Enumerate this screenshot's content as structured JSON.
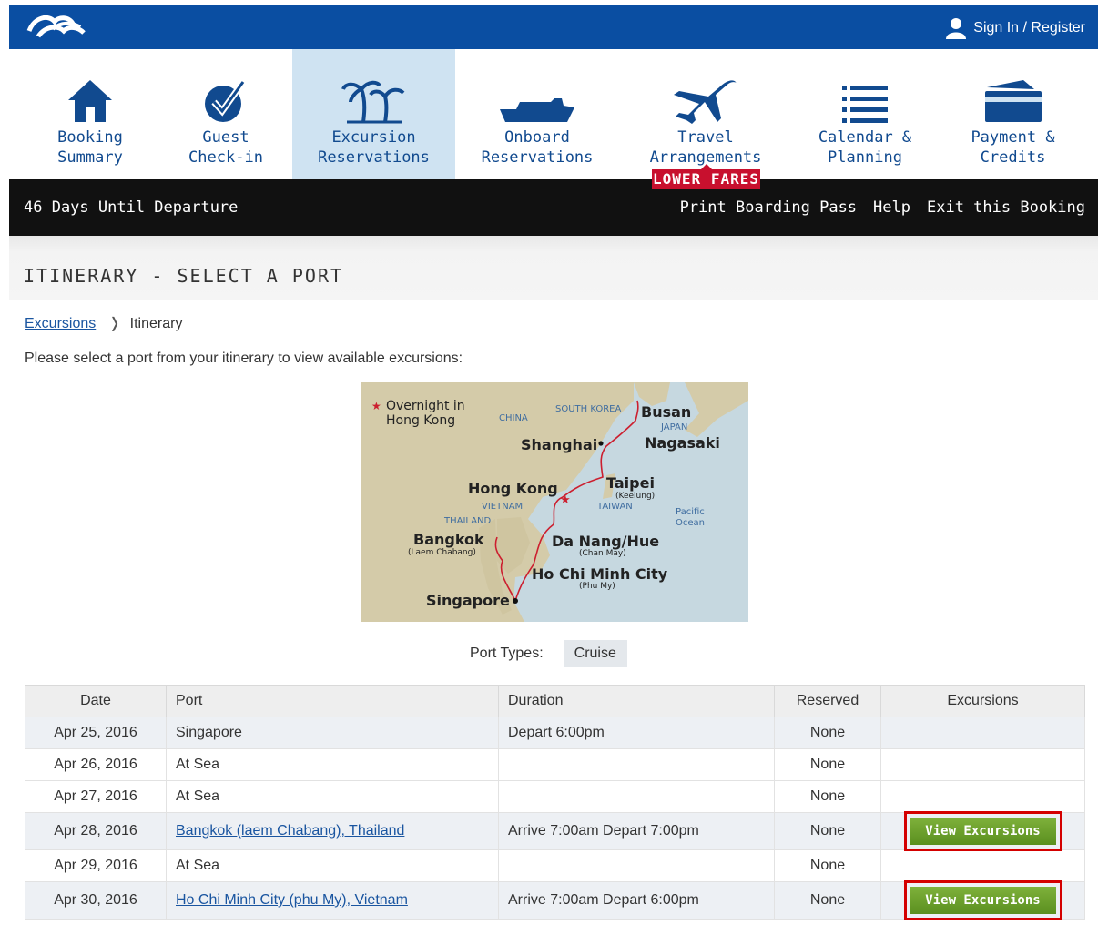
{
  "header": {
    "signin_label": "Sign In / Register"
  },
  "nav": [
    {
      "label": "Booking\nSummary",
      "icon": "home-icon"
    },
    {
      "label": "Guest\nCheck-in",
      "icon": "checkmark-icon"
    },
    {
      "label": "Excursion\nReservations",
      "icon": "palm-tree-icon",
      "active": true
    },
    {
      "label": "Onboard\nReservations",
      "icon": "ship-icon"
    },
    {
      "label": "Travel\nArrangements",
      "icon": "airplane-icon"
    },
    {
      "label": "Calendar &\nPlanning",
      "icon": "list-icon"
    },
    {
      "label": "Payment &\nCredits",
      "icon": "credit-card-icon"
    }
  ],
  "badge": "LOWER FARES",
  "bar": {
    "days": "46 Days Until Departure",
    "links": [
      "Print Boarding Pass",
      "Help",
      "Exit this Booking"
    ]
  },
  "page": {
    "title": "ITINERARY - SELECT A PORT",
    "breadcrumb": {
      "link": "Excursions",
      "current": "Itinerary"
    },
    "intro": "Please select a port from your itinerary to view available excursions:",
    "port_types_label": "Port Types:",
    "port_type": "Cruise"
  },
  "map": {
    "overnight": "Overnight in",
    "overnight2": "Hong Kong",
    "labels": {
      "china": "CHINA",
      "south_korea": "SOUTH KOREA",
      "busan": "Busan",
      "japan": "JAPAN",
      "shanghai": "Shanghai",
      "nagasaki": "Nagasaki",
      "hong_kong": "Hong Kong",
      "taipei": "Taipei",
      "keelung": "(Keelung)",
      "vietnam": "VIETNAM",
      "taiwan": "TAIWAN",
      "pacific": "Pacific",
      "ocean": "Ocean",
      "thailand": "THAILAND",
      "bangkok": "Bangkok",
      "laem": "(Laem Chabang)",
      "da_nang": "Da Nang/Hue",
      "chan_may": "(Chan May)",
      "hcmc": "Ho Chi Minh City",
      "phu_my": "(Phu My)",
      "singapore": "Singapore"
    }
  },
  "table": {
    "headers": [
      "Date",
      "Port",
      "Duration",
      "Reserved",
      "Excursions"
    ],
    "button_label": "View Excursions",
    "rows": [
      {
        "date": "Apr 25, 2016",
        "port": "Singapore",
        "duration": "Depart 6:00pm",
        "reserved": "None"
      },
      {
        "date": "Apr 26, 2016",
        "port": "At Sea",
        "duration": "",
        "reserved": "None"
      },
      {
        "date": "Apr 27, 2016",
        "port": "At Sea",
        "duration": "",
        "reserved": "None"
      },
      {
        "date": "Apr 28, 2016",
        "port": "Bangkok (laem Chabang), Thailand",
        "duration": "Arrive 7:00am Depart 7:00pm",
        "reserved": "None"
      },
      {
        "date": "Apr 29, 2016",
        "port": "At Sea",
        "duration": "",
        "reserved": "None"
      },
      {
        "date": "Apr 30, 2016",
        "port": "Ho Chi Minh City (phu My), Vietnam",
        "duration": "Arrive 7:00am Depart 6:00pm",
        "reserved": "None"
      }
    ]
  }
}
